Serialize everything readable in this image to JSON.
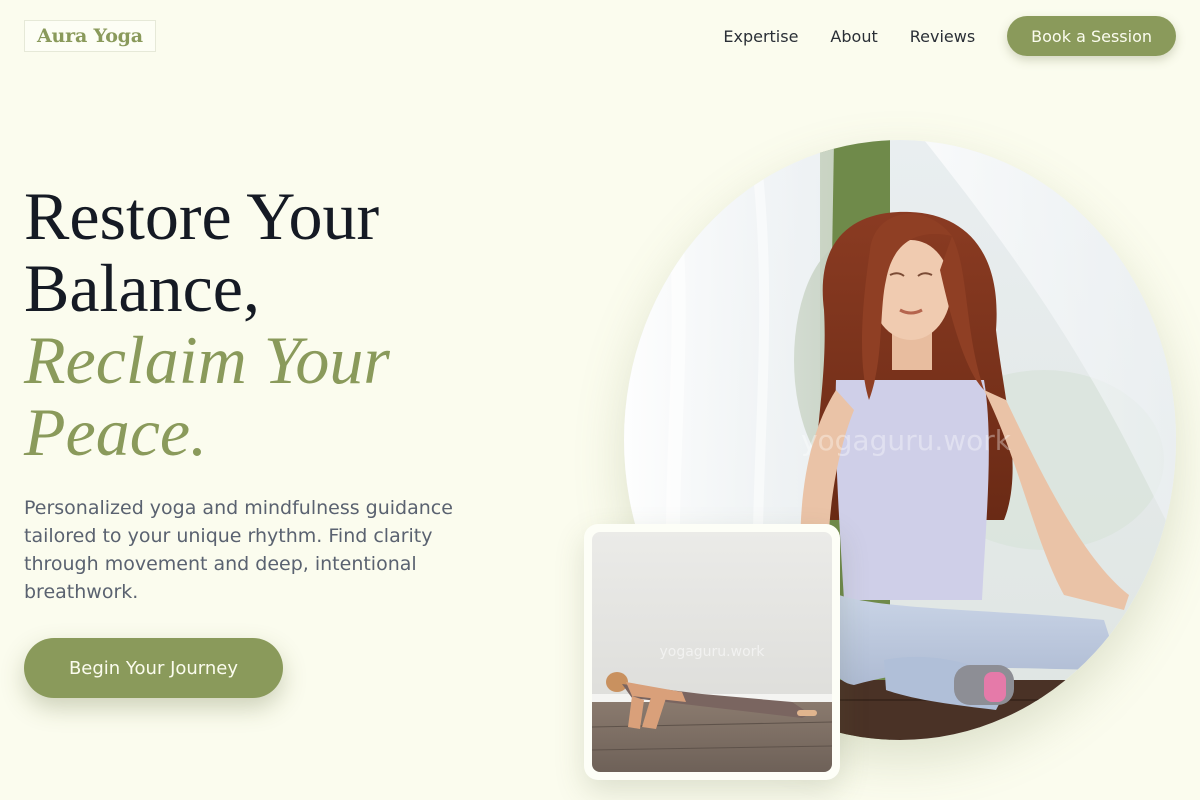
{
  "header": {
    "logo": "Aura Yoga",
    "nav": [
      "Expertise",
      "About",
      "Reviews"
    ],
    "cta": "Book a Session"
  },
  "hero": {
    "title_line1": "Restore Your",
    "title_line2": "Balance,",
    "accent_line1": "Reclaim Your",
    "accent_line2": "Peace.",
    "description": "Personalized yoga and mindfulness guidance tailored to your unique rhythm. Find clarity through movement and deep, intentional breathwork.",
    "cta": "Begin Your Journey"
  },
  "images": {
    "main": {
      "subject": "woman-meditating-photo",
      "watermark": "yogaguru.work"
    },
    "secondary": {
      "subject": "woman-plank-pose-photo",
      "watermark": "yogaguru.work"
    }
  },
  "colors": {
    "background": "#fbfcee",
    "accent": "#8a9a5b",
    "heading": "#151a24",
    "body_text": "#5a6270"
  }
}
